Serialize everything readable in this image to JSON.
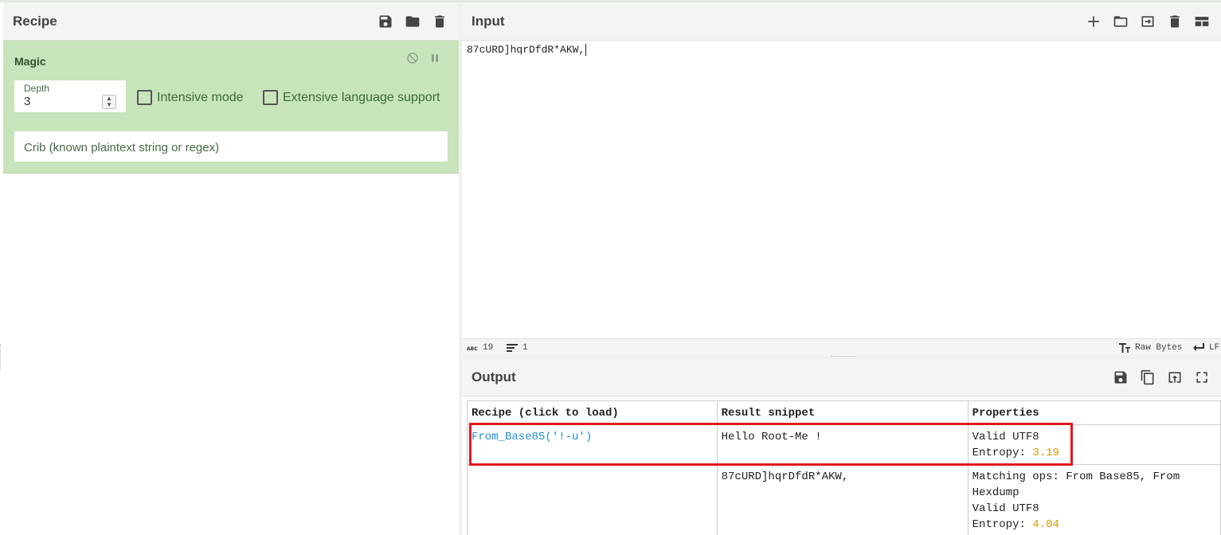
{
  "recipe": {
    "title": "Recipe",
    "icons": [
      "save-icon",
      "folder-icon",
      "trash-icon"
    ],
    "operation": {
      "name": "Magic",
      "depth_label": "Depth",
      "depth_value": "3",
      "intensive_label": "Intensive mode",
      "intensive_checked": false,
      "extensive_label": "Extensive language support",
      "extensive_checked": false,
      "crib_placeholder": "Crib (known plaintext string or regex)",
      "color": "#c7e4bb"
    }
  },
  "input": {
    "title": "Input",
    "icons": [
      "plus-icon",
      "folder-icon",
      "import-icon",
      "trash-icon",
      "layout-icon"
    ],
    "text": "87cURD]hqrDfdR*AKW,",
    "status": {
      "chars": "19",
      "lines": "1",
      "encoding": "Raw Bytes",
      "eol": "LF"
    }
  },
  "output": {
    "title": "Output",
    "icons": [
      "save-icon",
      "copy-icon",
      "replace-input-icon",
      "fullscreen-icon"
    ],
    "table": {
      "headers": [
        "Recipe (click to load)",
        "Result snippet",
        "Properties"
      ],
      "rows": [
        {
          "recipe": "From_Base85('!-u')",
          "snippet": "Hello Root-Me !",
          "props_line1": "Valid UTF8",
          "entropy_label": "Entropy: ",
          "entropy_value": "3.19"
        },
        {
          "recipe": "",
          "snippet": "87cURD]hqrDfdR*AKW,",
          "props_line1": "Matching ops: From Base85, From",
          "props_line2": "Hexdump",
          "props_line3": "Valid UTF8",
          "entropy_label": "Entropy: ",
          "entropy_value": "4.04"
        }
      ]
    },
    "highlight_color": "#e4171c",
    "link_color": "#1e8fd6",
    "entropy_color": "#d49a0a"
  }
}
